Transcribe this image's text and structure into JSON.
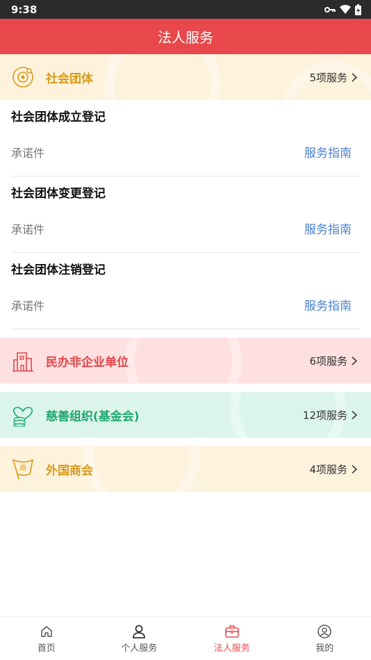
{
  "status": {
    "time": "9:38"
  },
  "header": {
    "title": "法人服务"
  },
  "categories": [
    {
      "title": "社会团体",
      "count": "5项服务",
      "icon": "social-group-icon",
      "color": "#d89b1a"
    },
    {
      "title": "民办非企业单位",
      "count": "6项服务",
      "icon": "building-icon",
      "color": "#e0454a"
    },
    {
      "title": "慈善组织(基金会)",
      "count": "12项服务",
      "icon": "charity-coins-icon",
      "color": "#1fa86e"
    },
    {
      "title": "外国商会",
      "count": "4项服务",
      "icon": "chamber-flag-icon",
      "color": "#d89b1a"
    }
  ],
  "services": [
    {
      "name": "社会团体成立登记",
      "tag": "承诺件",
      "guide": "服务指南"
    },
    {
      "name": "社会团体变更登记",
      "tag": "承诺件",
      "guide": "服务指南"
    },
    {
      "name": "社会团体注销登记",
      "tag": "承诺件",
      "guide": "服务指南"
    }
  ],
  "tabbar": [
    {
      "label": "首页",
      "icon": "home-icon"
    },
    {
      "label": "个人服务",
      "icon": "person-icon"
    },
    {
      "label": "法人服务",
      "icon": "briefcase-icon",
      "active": true
    },
    {
      "label": "我的",
      "icon": "profile-icon"
    }
  ],
  "accent_color": "#e8484b"
}
